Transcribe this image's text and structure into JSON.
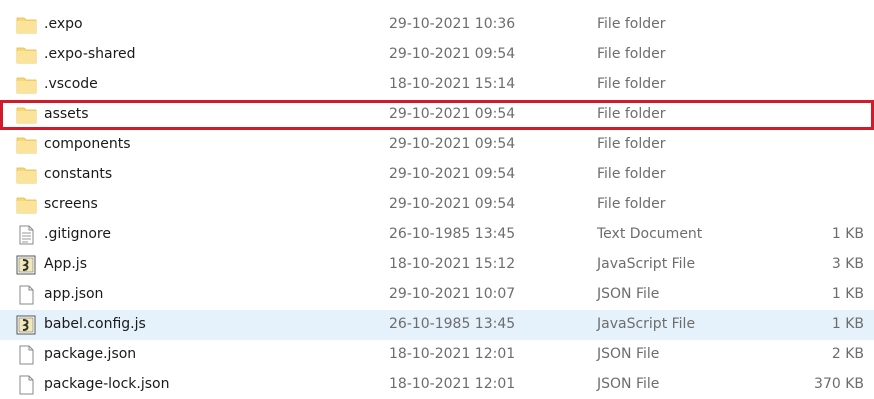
{
  "files": [
    {
      "name": ".expo",
      "date": "29-10-2021 10:36",
      "type": "File folder",
      "size": "",
      "icon": "folder-icon"
    },
    {
      "name": ".expo-shared",
      "date": "29-10-2021 09:54",
      "type": "File folder",
      "size": "",
      "icon": "folder-icon"
    },
    {
      "name": ".vscode",
      "date": "18-10-2021 15:14",
      "type": "File folder",
      "size": "",
      "icon": "folder-icon"
    },
    {
      "name": "assets",
      "date": "29-10-2021 09:54",
      "type": "File folder",
      "size": "",
      "icon": "folder-icon"
    },
    {
      "name": "components",
      "date": "29-10-2021 09:54",
      "type": "File folder",
      "size": "",
      "icon": "folder-icon"
    },
    {
      "name": "constants",
      "date": "29-10-2021 09:54",
      "type": "File folder",
      "size": "",
      "icon": "folder-icon"
    },
    {
      "name": "screens",
      "date": "29-10-2021 09:54",
      "type": "File folder",
      "size": "",
      "icon": "folder-icon"
    },
    {
      "name": ".gitignore",
      "date": "26-10-1985 13:45",
      "type": "Text Document",
      "size": "1 KB",
      "icon": "text-document-icon"
    },
    {
      "name": "App.js",
      "date": "18-10-2021 15:12",
      "type": "JavaScript File",
      "size": "3 KB",
      "icon": "javascript-file-icon"
    },
    {
      "name": "app.json",
      "date": "29-10-2021 10:07",
      "type": "JSON File",
      "size": "1 KB",
      "icon": "blank-file-icon"
    },
    {
      "name": "babel.config.js",
      "date": "26-10-1985 13:45",
      "type": "JavaScript File",
      "size": "1 KB",
      "icon": "javascript-file-icon"
    },
    {
      "name": "package.json",
      "date": "18-10-2021 12:01",
      "type": "JSON File",
      "size": "2 KB",
      "icon": "blank-file-icon"
    },
    {
      "name": "package-lock.json",
      "date": "18-10-2021 12:01",
      "type": "JSON File",
      "size": "370 KB",
      "icon": "blank-file-icon"
    }
  ],
  "colors": {
    "highlight_border": "#d11a2a",
    "selected_row": "#e5f1fb",
    "folder": "#f8d775"
  }
}
